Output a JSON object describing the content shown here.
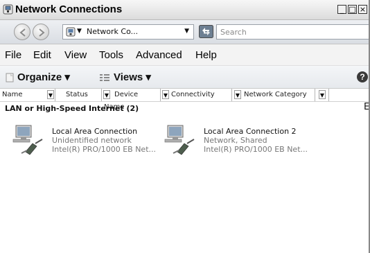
{
  "window": {
    "title": "Network Connections"
  },
  "title_buttons": {
    "minimize": "_",
    "maximize": "□",
    "close": "×"
  },
  "address": {
    "path": "Network Co..."
  },
  "search": {
    "placeholder": "Search"
  },
  "menu": [
    "File",
    "Edit",
    "View",
    "Tools",
    "Advanced",
    "Help"
  ],
  "command": {
    "organize": "Organize",
    "views": "Views",
    "help": "?"
  },
  "columns": [
    "Name",
    "Status",
    "Device Name",
    "Connectivity",
    "Network Category"
  ],
  "group": {
    "label": "LAN or High-Speed Internet (2)",
    "side_letter": "E"
  },
  "items": [
    {
      "name": "Local Area Connection",
      "status": "Unidentified network",
      "device": "Intel(R) PRO/1000 EB Net..."
    },
    {
      "name": "Local Area Connection 2",
      "status": "Network, Shared",
      "device": "Intel(R) PRO/1000 EB Net..."
    }
  ],
  "icons": [
    "network-connections-icon",
    "back-arrow-icon",
    "forward-arrow-icon",
    "address-folder-icon",
    "refresh-icon",
    "organize-icon",
    "views-icon",
    "help-icon",
    "network-adapter-icon"
  ]
}
